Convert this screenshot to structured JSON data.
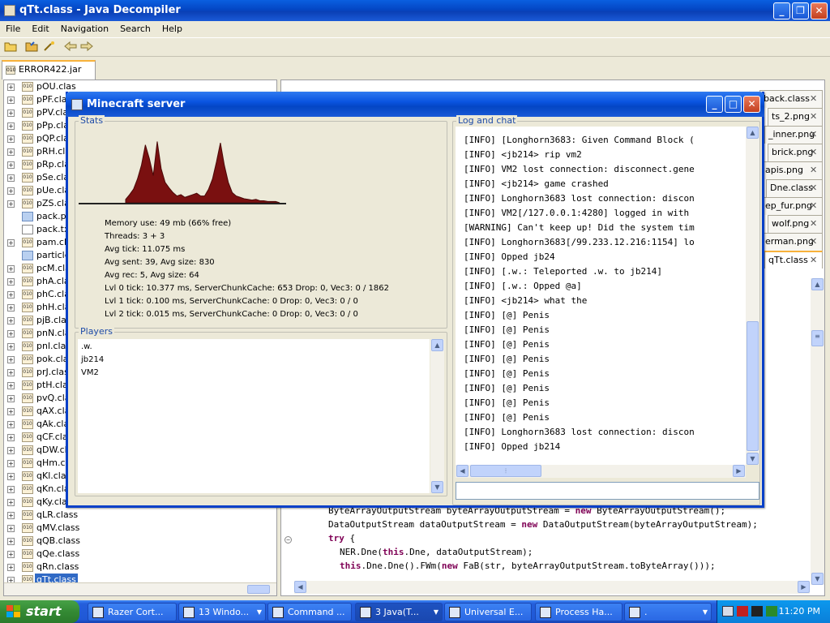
{
  "jd": {
    "title": "qTt.class - Java Decompiler",
    "menu": [
      "File",
      "Edit",
      "Navigation",
      "Search",
      "Help"
    ],
    "file_tab": "ERROR422.jar",
    "tree_items": [
      {
        "name": "pOU.clas",
        "kind": "class"
      },
      {
        "name": "pPF.clas",
        "kind": "class"
      },
      {
        "name": "pPV.clas",
        "kind": "class"
      },
      {
        "name": "pPp.clas",
        "kind": "class"
      },
      {
        "name": "pQP.clas",
        "kind": "class"
      },
      {
        "name": "pRH.clas",
        "kind": "class"
      },
      {
        "name": "pRp.clas",
        "kind": "class"
      },
      {
        "name": "pSe.clas",
        "kind": "class"
      },
      {
        "name": "pUe.clas",
        "kind": "class"
      },
      {
        "name": "pZS.clas",
        "kind": "class"
      },
      {
        "name": "pack.pn",
        "kind": "png"
      },
      {
        "name": "pack.tx",
        "kind": "txt"
      },
      {
        "name": "pam.cla",
        "kind": "class"
      },
      {
        "name": "particles",
        "kind": "png"
      },
      {
        "name": "pcM.cla",
        "kind": "class"
      },
      {
        "name": "phA.clas",
        "kind": "class"
      },
      {
        "name": "phC.clas",
        "kind": "class"
      },
      {
        "name": "phH.clas",
        "kind": "class"
      },
      {
        "name": "pjB.clas",
        "kind": "class"
      },
      {
        "name": "pnN.clas",
        "kind": "class"
      },
      {
        "name": "pnl.clas",
        "kind": "class"
      },
      {
        "name": "pok.clas",
        "kind": "class"
      },
      {
        "name": "prJ.clas",
        "kind": "class"
      },
      {
        "name": "ptH.clas",
        "kind": "class"
      },
      {
        "name": "pvQ.clas",
        "kind": "class"
      },
      {
        "name": "qAX.clas",
        "kind": "class"
      },
      {
        "name": "qAk.clas",
        "kind": "class"
      },
      {
        "name": "qCF.clas",
        "kind": "class"
      },
      {
        "name": "qDW.cla",
        "kind": "class"
      },
      {
        "name": "qHm.cla",
        "kind": "class"
      },
      {
        "name": "qKl.clas",
        "kind": "class"
      },
      {
        "name": "qKn.clas",
        "kind": "class"
      },
      {
        "name": "qKy.class",
        "kind": "class"
      },
      {
        "name": "qLR.class",
        "kind": "class"
      },
      {
        "name": "qMV.class",
        "kind": "class"
      },
      {
        "name": "qQB.class",
        "kind": "class"
      },
      {
        "name": "qQe.class",
        "kind": "class"
      },
      {
        "name": "qRn.class",
        "kind": "class"
      },
      {
        "name": "qTt.class",
        "kind": "class",
        "selected": true
      }
    ],
    "code_tabs": [
      "back.class",
      "ts_2.png",
      "_inner.png",
      "brick.png",
      "apis.png",
      "Dne.class",
      "ep_fur.png",
      "wolf.png",
      "erman.png",
      "qTt.class"
    ],
    "code_lines": [
      "ByteArrayOutputStream byteArrayOutputStream = new ByteArrayOutputStream();",
      "DataOutputStream dataOutputStream = new DataOutputStream(byteArrayOutputStream);",
      "try {",
      "NER.Dne(this.Dne, dataOutputStream);",
      "this.Dne.Dne().FWm(new FaB(str, byteArrayOutputStream.toByteArray()));"
    ]
  },
  "mc": {
    "title": "Minecraft server",
    "stats_legend": "Stats",
    "graph_peaks": [
      0.05,
      0.12,
      0.2,
      0.35,
      0.55,
      0.85,
      0.65,
      0.4,
      0.9,
      0.5,
      0.3,
      0.22,
      0.15,
      0.1,
      0.12,
      0.08,
      0.1,
      0.12,
      0.14,
      0.1,
      0.1,
      0.2,
      0.35,
      0.6,
      0.88,
      0.55,
      0.3,
      0.15,
      0.1,
      0.08,
      0.06,
      0.05,
      0.04,
      0.05,
      0.03,
      0.03,
      0.02,
      0.02,
      0.02
    ],
    "stats": [
      "Memory use: 49 mb (66% free)",
      "Threads: 3 + 3",
      "Avg tick: 11.075 ms",
      "Avg sent: 39, Avg size: 830",
      "Avg rec: 5, Avg size: 64",
      "Lvl 0 tick: 10.377 ms, ServerChunkCache: 653 Drop: 0, Vec3: 0 / 1862",
      "Lvl 1 tick: 0.100 ms, ServerChunkCache: 0 Drop: 0, Vec3: 0 / 0",
      "Lvl 2 tick: 0.015 ms, ServerChunkCache: 0 Drop: 0, Vec3: 0 / 0"
    ],
    "players_legend": "Players",
    "players": [
      ".w.",
      "jb214",
      "VM2"
    ],
    "log_legend": "Log and chat",
    "log": [
      "[INFO] [Longhorn3683: Given Command Block (",
      "[INFO] <jb214> rip vm2",
      "[INFO] VM2 lost connection: disconnect.gene",
      "[INFO] <jb214> game crashed",
      "[INFO] Longhorn3683 lost connection: discon",
      "[INFO] VM2[/127.0.0.1:4280] logged in with",
      "[WARNING] Can't keep up! Did the system tim",
      "[INFO] Longhorn3683[/99.233.12.216:1154] lo",
      "[INFO] Opped jb24",
      "[INFO] [.w.: Teleported .w. to jb214]",
      "[INFO] [.w.: Opped @a]",
      "[INFO] <jb214> what the",
      "[INFO] [@] Penis",
      "[INFO] [@] Penis",
      "[INFO] [@] Penis",
      "[INFO] [@] Penis",
      "[INFO] [@] Penis",
      "[INFO] [@] Penis",
      "[INFO] [@] Penis",
      "[INFO] [@] Penis",
      "[INFO] Longhorn3683 lost connection: discon",
      "[INFO] Opped jb214"
    ],
    "chat_value": ""
  },
  "taskbar": {
    "start": "start",
    "tasks": [
      "Razer Cort...",
      "13 Windo...",
      "Command ...",
      "3 Java(T...",
      "Universal E...",
      "Process Ha...",
      "."
    ],
    "clock": "11:20 PM"
  }
}
